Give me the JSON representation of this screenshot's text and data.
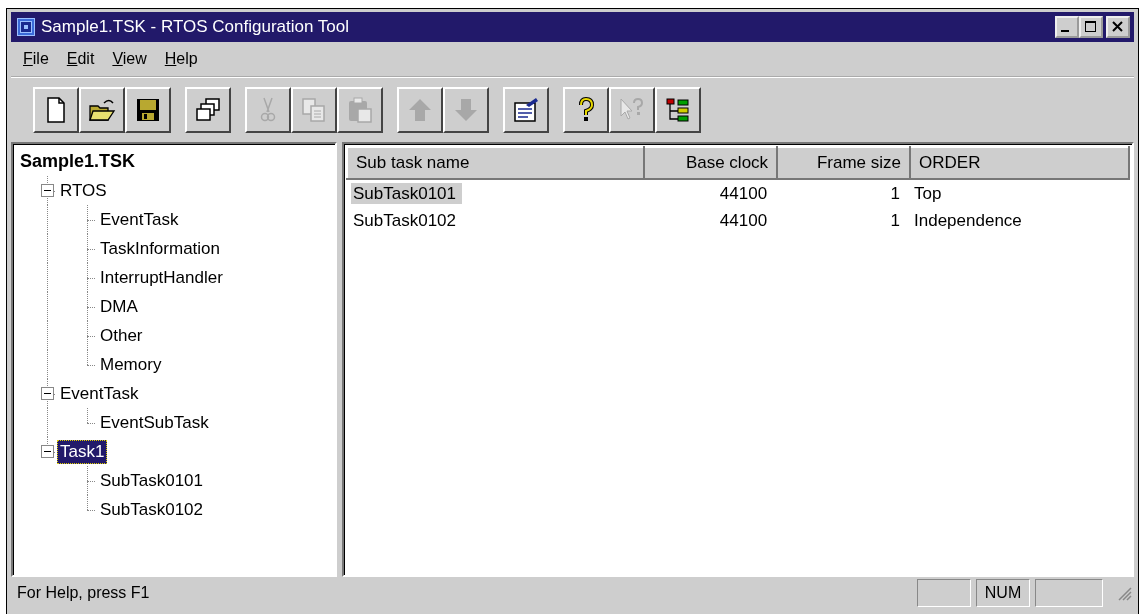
{
  "window": {
    "title": "Sample1.TSK - RTOS Configuration Tool"
  },
  "menu": [
    {
      "label": "File"
    },
    {
      "label": "Edit"
    },
    {
      "label": "View"
    },
    {
      "label": "Help"
    }
  ],
  "toolbar": [
    [
      {
        "kind": "new",
        "disabled": false
      },
      {
        "kind": "open",
        "disabled": false
      },
      {
        "kind": "save",
        "disabled": false
      }
    ],
    [
      {
        "kind": "windows",
        "disabled": false
      }
    ],
    [
      {
        "kind": "cut",
        "disabled": true
      },
      {
        "kind": "copy",
        "disabled": true
      },
      {
        "kind": "paste",
        "disabled": true
      }
    ],
    [
      {
        "kind": "up",
        "disabled": true
      },
      {
        "kind": "down",
        "disabled": true
      }
    ],
    [
      {
        "kind": "properties",
        "disabled": false
      }
    ],
    [
      {
        "kind": "help",
        "disabled": false
      },
      {
        "kind": "context_help",
        "disabled": true
      },
      {
        "kind": "tree",
        "disabled": false
      }
    ]
  ],
  "tree": {
    "label": "Sample1.TSK",
    "children": [
      {
        "label": "RTOS",
        "expanded": true,
        "selected": false,
        "children": [
          {
            "label": "EventTask",
            "selected": false
          },
          {
            "label": "TaskInformation",
            "selected": false
          },
          {
            "label": "InterruptHandler",
            "selected": false
          },
          {
            "label": "DMA",
            "selected": false
          },
          {
            "label": "Other",
            "selected": false
          },
          {
            "label": "Memory",
            "selected": false
          }
        ]
      },
      {
        "label": "EventTask",
        "expanded": true,
        "selected": false,
        "children": [
          {
            "label": "EventSubTask",
            "selected": false
          }
        ]
      },
      {
        "label": "Task1",
        "expanded": true,
        "selected": true,
        "children": [
          {
            "label": "SubTask0101",
            "selected": false
          },
          {
            "label": "SubTask0102",
            "selected": false
          }
        ]
      }
    ]
  },
  "table": {
    "columns": [
      {
        "label": "Sub task name",
        "kind": "text"
      },
      {
        "label": "Base clock",
        "kind": "number"
      },
      {
        "label": "Frame size",
        "kind": "number"
      },
      {
        "label": "ORDER",
        "kind": "text"
      }
    ],
    "rows": [
      {
        "cells": [
          "SubTask0101",
          "44100",
          "1",
          "Top"
        ],
        "selected": true
      },
      {
        "cells": [
          "SubTask0102",
          "44100",
          "1",
          "Independence"
        ],
        "selected": false
      }
    ]
  },
  "status_bar": {
    "text": "For Help, press F1",
    "panels": [
      {
        "kind": "empty"
      },
      {
        "kind": "text",
        "label": "NUM"
      },
      {
        "kind": "empty"
      }
    ]
  }
}
